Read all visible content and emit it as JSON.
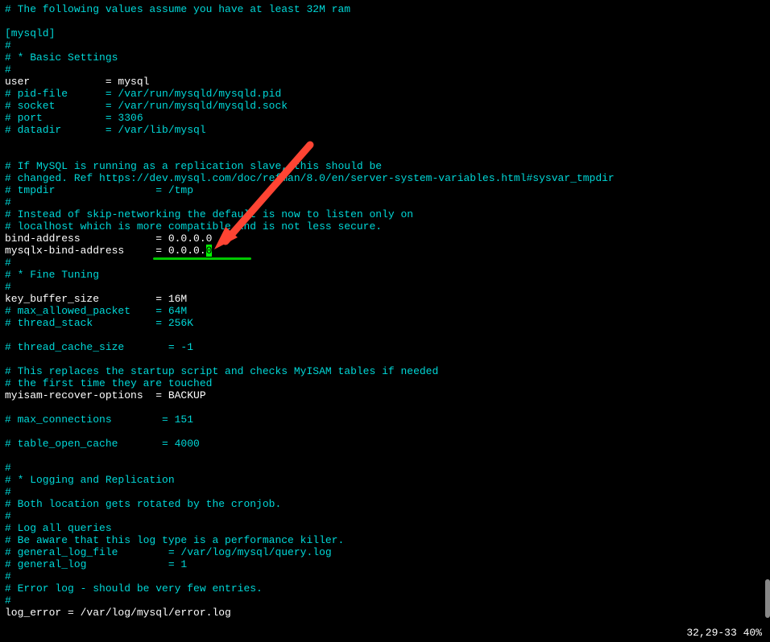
{
  "lines": [
    {
      "type": "comment",
      "text": "# The following values assume you have at least 32M ram"
    },
    {
      "type": "blank",
      "text": ""
    },
    {
      "type": "bracket",
      "text": "[mysqld]"
    },
    {
      "type": "comment",
      "text": "#"
    },
    {
      "type": "comment",
      "text": "# * Basic Settings"
    },
    {
      "type": "comment",
      "text": "#"
    },
    {
      "type": "normal",
      "text": "user            = mysql"
    },
    {
      "type": "comment",
      "text": "# pid-file      = /var/run/mysqld/mysqld.pid"
    },
    {
      "type": "comment",
      "text": "# socket        = /var/run/mysqld/mysqld.sock"
    },
    {
      "type": "comment",
      "text": "# port          = 3306"
    },
    {
      "type": "comment",
      "text": "# datadir       = /var/lib/mysql"
    },
    {
      "type": "blank",
      "text": ""
    },
    {
      "type": "blank",
      "text": ""
    },
    {
      "type": "comment",
      "text": "# If MySQL is running as a replication slave, this should be"
    },
    {
      "type": "comment",
      "text": "# changed. Ref https://dev.mysql.com/doc/refman/8.0/en/server-system-variables.html#sysvar_tmpdir"
    },
    {
      "type": "comment",
      "text": "# tmpdir                = /tmp"
    },
    {
      "type": "comment",
      "text": "#"
    },
    {
      "type": "comment",
      "text": "# Instead of skip-networking the default is now to listen only on"
    },
    {
      "type": "comment",
      "text": "# localhost which is more compatible and is not less secure."
    },
    {
      "type": "normal",
      "text": "bind-address            = 0.0.0.0"
    },
    {
      "type": "cursor-line",
      "text": "mysqlx-bind-address     = 0.0.0.",
      "cursor": "0"
    },
    {
      "type": "comment",
      "text": "#"
    },
    {
      "type": "comment",
      "text": "# * Fine Tuning"
    },
    {
      "type": "comment",
      "text": "#"
    },
    {
      "type": "normal",
      "text": "key_buffer_size         = 16M"
    },
    {
      "type": "comment",
      "text": "# max_allowed_packet    = 64M"
    },
    {
      "type": "comment",
      "text": "# thread_stack          = 256K"
    },
    {
      "type": "blank",
      "text": ""
    },
    {
      "type": "comment",
      "text": "# thread_cache_size       = -1"
    },
    {
      "type": "blank",
      "text": ""
    },
    {
      "type": "comment",
      "text": "# This replaces the startup script and checks MyISAM tables if needed"
    },
    {
      "type": "comment",
      "text": "# the first time they are touched"
    },
    {
      "type": "normal",
      "text": "myisam-recover-options  = BACKUP"
    },
    {
      "type": "blank",
      "text": ""
    },
    {
      "type": "comment",
      "text": "# max_connections        = 151"
    },
    {
      "type": "blank",
      "text": ""
    },
    {
      "type": "comment",
      "text": "# table_open_cache       = 4000"
    },
    {
      "type": "blank",
      "text": ""
    },
    {
      "type": "comment",
      "text": "#"
    },
    {
      "type": "comment",
      "text": "# * Logging and Replication"
    },
    {
      "type": "comment",
      "text": "#"
    },
    {
      "type": "comment",
      "text": "# Both location gets rotated by the cronjob."
    },
    {
      "type": "comment",
      "text": "#"
    },
    {
      "type": "comment",
      "text": "# Log all queries"
    },
    {
      "type": "comment",
      "text": "# Be aware that this log type is a performance killer."
    },
    {
      "type": "comment",
      "text": "# general_log_file        = /var/log/mysql/query.log"
    },
    {
      "type": "comment",
      "text": "# general_log             = 1"
    },
    {
      "type": "comment",
      "text": "#"
    },
    {
      "type": "comment",
      "text": "# Error log - should be very few entries."
    },
    {
      "type": "comment",
      "text": "#"
    },
    {
      "type": "normal",
      "text": "log_error = /var/log/mysql/error.log"
    }
  ],
  "status": {
    "position": "32,29-33",
    "percent": "40%"
  }
}
